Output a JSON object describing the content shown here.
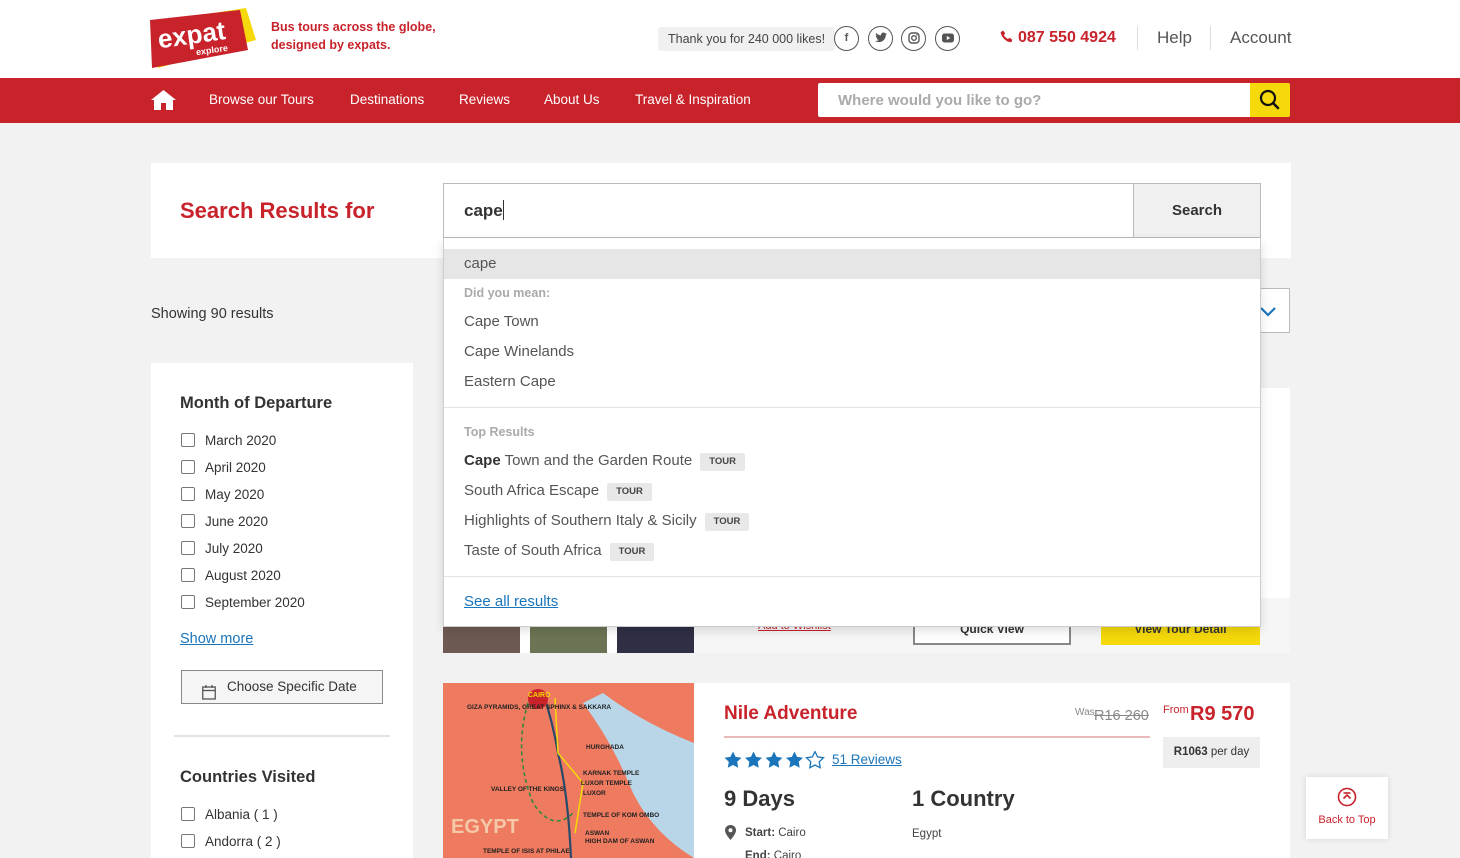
{
  "header": {
    "logo_text": "expat explore",
    "tagline_line1": "Bus tours across the globe,",
    "tagline_line2": "designed by expats.",
    "likes": "Thank you for 240 000 likes!",
    "social_icons": [
      "facebook-icon",
      "twitter-icon",
      "instagram-icon",
      "youtube-icon"
    ],
    "phone": "087 550 4924",
    "help": "Help",
    "account": "Account"
  },
  "nav": {
    "items": [
      "Browse our Tours",
      "Destinations",
      "Reviews",
      "About Us",
      "Travel & Inspiration"
    ],
    "search_placeholder": "Where would you like to go?"
  },
  "search": {
    "title": "Search Results for",
    "query": "cape",
    "button": "Search",
    "showing": "Showing 90 results"
  },
  "dropdown": {
    "current": "cape",
    "did_you_mean_label": "Did you mean:",
    "suggestions": [
      "Cape Town",
      "Cape Winelands",
      "Eastern Cape"
    ],
    "top_results_label": "Top Results",
    "top_results": [
      {
        "bold": "Cape",
        "rest": " Town and the Garden Route",
        "tag": "TOUR"
      },
      {
        "bold": "",
        "rest": "South Africa Escape",
        "tag": "TOUR"
      },
      {
        "bold": "",
        "rest": "Highlights of Southern Italy & Sicily",
        "tag": "TOUR"
      },
      {
        "bold": "",
        "rest": "Taste of South Africa",
        "tag": "TOUR"
      }
    ],
    "see_all": "See all results"
  },
  "filters": {
    "month_title": "Month of Departure",
    "months": [
      "March 2020",
      "April 2020",
      "May 2020",
      "June 2020",
      "July 2020",
      "August 2020",
      "September 2020"
    ],
    "show_more": "Show more",
    "specific_date": "Choose Specific Date",
    "countries_title": "Countries Visited",
    "countries": [
      "Albania ( 1 )",
      "Andorra ( 2 )"
    ]
  },
  "card1": {
    "wishlist": "Add to Wishlist",
    "quick_view": "Quick View",
    "view_detail": "View Tour Detail"
  },
  "tour": {
    "name": "Nile Adventure",
    "was_label": "Was",
    "was_price": "R16 260",
    "from_label": "From",
    "price": "R9 570",
    "per_day_amount": "R1063",
    "per_day_label": "per day",
    "rating": 4.5,
    "reviews": "51 Reviews",
    "days": "9 Days",
    "countries": "1 Country",
    "start_label": "Start:",
    "start": "Cairo",
    "end_label": "End:",
    "end": "Cairo",
    "country_list": "Egypt",
    "map_labels": [
      "GIZA PYRAMIDS, GREAT SPHINX & SAKKARA",
      "CAIRO",
      "HURGHADA",
      "VALLEY OF THE KINGS",
      "KARNAK TEMPLE",
      "LUXOR TEMPLE",
      "LUXOR",
      "EGYPT",
      "TEMPLE OF KOM OMBO",
      "ASWAN",
      "HIGH DAM OF ASWAN",
      "TEMPLE OF ISIS AT PHILAE"
    ]
  },
  "back_to_top": "Back to Top",
  "colors": {
    "brand_red": "#c8222b",
    "accent_yellow": "#f5d90a",
    "link_blue": "#1a75bb",
    "star_blue": "#1a75bb"
  }
}
